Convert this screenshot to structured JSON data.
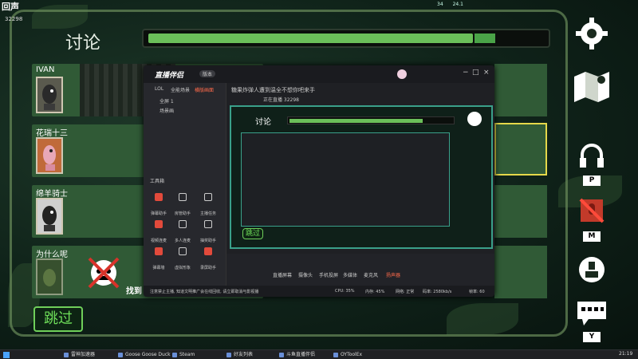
{
  "stream_overlay": {
    "logo_text": "回声",
    "viewer_count": "32298"
  },
  "hud": {
    "top_value_1": "34",
    "top_value_2": "24.1"
  },
  "game": {
    "discussion_title": "讨论",
    "timer_progress": 0.82,
    "players": [
      {
        "name": "IVAN"
      },
      {
        "name": "花瑞十三"
      },
      {
        "name": "绵羊骑士"
      },
      {
        "name": "为什么呢"
      }
    ],
    "skip_label": "跳过",
    "found_label": "找到",
    "keys": {
      "push_to_talk": "P",
      "mute": "M",
      "vote": "Y"
    }
  },
  "companion_app": {
    "title": "直播伴侣",
    "version_badge": "版本",
    "tabs": [
      "LOL",
      "全能场景",
      "横版画面"
    ],
    "scene_items": [
      "全屏 1",
      "场景画"
    ],
    "marquee": "糖果炸弹人遭到温全不想你吧来手",
    "toolbox_label": "工具箱",
    "tools": [
      "弹幕助手",
      "房管助手",
      "主播任务",
      "视频连麦",
      "多人连麦",
      "抽奖助手",
      "弹幕墙",
      "虚拟形象",
      "录屏助手"
    ],
    "preview_subtitle": "正在直播 32298",
    "bottom_buttons": [
      "直播屏幕",
      "摄像头",
      "手机投屏",
      "多媒体",
      "麦克风",
      "扬声器"
    ],
    "notice": "注意禁止主播, 知道文明推广会在线回收, 请立即取消与影视播",
    "status_bar": [
      "CPU: 35%",
      "内存: 45%",
      "网络: 正常",
      "码率: 2580kb/s",
      "帧率: 60"
    ]
  },
  "taskbar": {
    "items": [
      "雷神加速器",
      "Goose Goose Duck",
      "Steam",
      "好友列表",
      "斗鱼直播伴侣",
      "OYToolEx"
    ],
    "clock": "21:19"
  }
}
